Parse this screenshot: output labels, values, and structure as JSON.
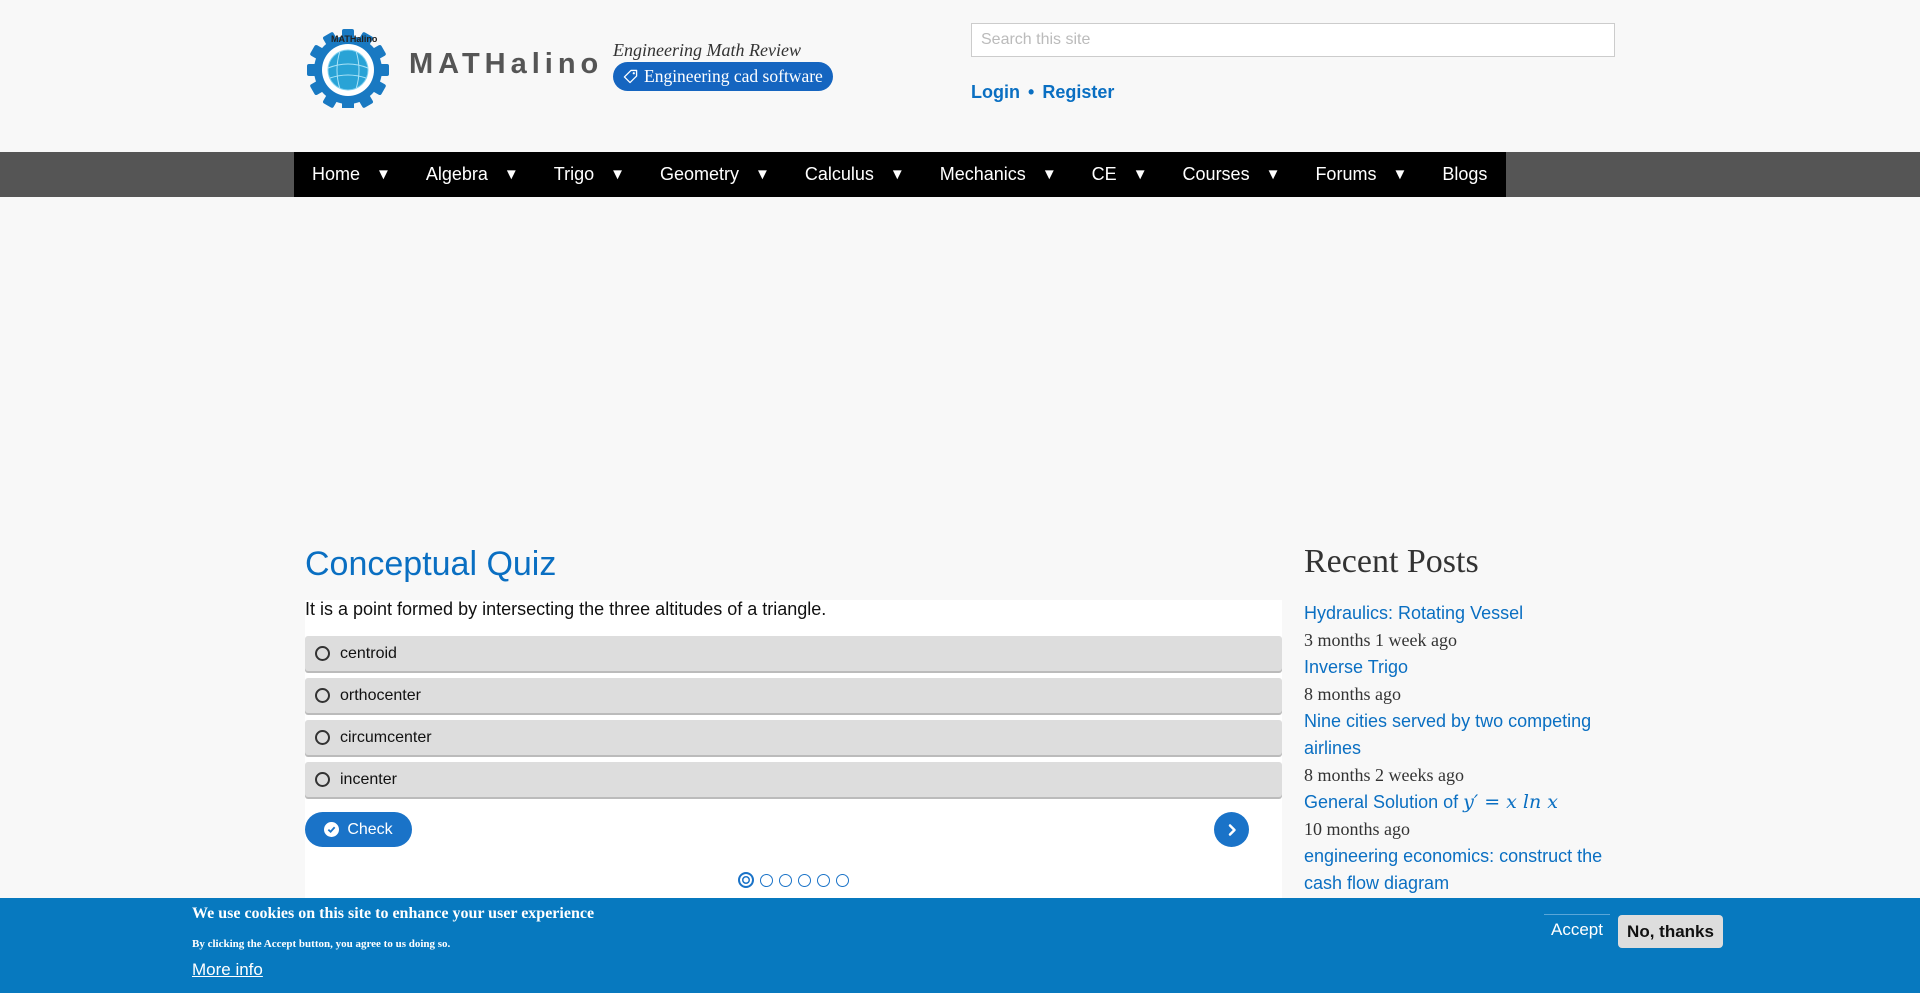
{
  "header": {
    "site_name": "MATHalino",
    "logo_text": "MATHalino",
    "slogan": "Engineering Math Review",
    "cad_badge_label": "Engineering cad software",
    "search": {
      "placeholder": "Search this site",
      "value": ""
    },
    "login_label": "Login",
    "separator": "•",
    "register_label": "Register"
  },
  "nav": {
    "items": [
      {
        "label": "Home",
        "arrow": "▼"
      },
      {
        "label": "Algebra",
        "arrow": "▼"
      },
      {
        "label": "Trigo",
        "arrow": "▼"
      },
      {
        "label": "Geometry",
        "arrow": "▼"
      },
      {
        "label": "Calculus",
        "arrow": "▼"
      },
      {
        "label": "Mechanics",
        "arrow": "▼"
      },
      {
        "label": "CE",
        "arrow": "▼"
      },
      {
        "label": "Courses",
        "arrow": "▼"
      },
      {
        "label": "Forums",
        "arrow": "▼"
      },
      {
        "label": "Blogs"
      }
    ]
  },
  "quiz": {
    "title": "Conceptual Quiz",
    "question": "It is a point formed by intersecting the three altitudes of a triangle.",
    "options": [
      "centroid",
      "orthocenter",
      "circumcenter",
      "incenter"
    ],
    "check_label": "Check",
    "current_page": 1,
    "total_pages": 6
  },
  "sidebar": {
    "title": "Recent Posts",
    "posts": [
      {
        "title": "Hydraulics: Rotating Vessel",
        "time": "3 months 1 week ago"
      },
      {
        "title": "Inverse Trigo",
        "time": "8 months ago"
      },
      {
        "title": "Nine cities served by two competing airlines",
        "time": "8 months 2 weeks ago"
      },
      {
        "title": "General Solution of",
        "math": "y′ = x ln x",
        "time": "10 months ago"
      },
      {
        "title": "engineering economics: construct the cash flow diagram"
      }
    ]
  },
  "cookie": {
    "title": "We use cookies on this site to enhance your user experience",
    "subtitle": "By clicking the Accept button, you agree to us doing so.",
    "more_info": "More info",
    "accept_label": "Accept",
    "decline_label": "No, thanks"
  },
  "colors": {
    "link": "#0a6fc2",
    "nav_bg": "#000000",
    "navbar_bg": "#555555",
    "button_blue": "#1a73c8",
    "cookie_bg": "#0779bf",
    "badge_bg": "#1565c0"
  }
}
